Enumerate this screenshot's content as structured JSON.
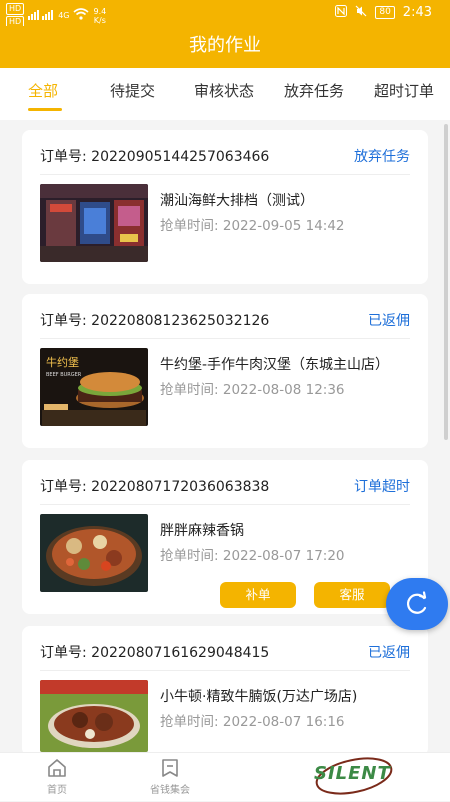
{
  "status_bar": {
    "net1": "HD",
    "net2": "HD",
    "signal_label": "4G",
    "speed_value": "9.4",
    "speed_unit": "K/s",
    "battery": "80",
    "time": "2:43"
  },
  "header": {
    "title": "我的作业"
  },
  "tabs": [
    {
      "label": "全部",
      "active": true
    },
    {
      "label": "待提交",
      "active": false
    },
    {
      "label": "审核状态",
      "active": false
    },
    {
      "label": "放弃任务",
      "active": false
    },
    {
      "label": "超时订单",
      "active": false
    }
  ],
  "orders": [
    {
      "order_label": "订单号:",
      "order_no": "20220905144257063466",
      "status": "放弃任务",
      "shop": "潮汕海鲜大排档（测试）",
      "time_label": "抢单时间:",
      "time": "2022-09-05 14:42",
      "image": "restaurant-storefront"
    },
    {
      "order_label": "订单号:",
      "order_no": "20220808123625032126",
      "status": "已返佣",
      "shop": "牛约堡-手作牛肉汉堡（东城主山店）",
      "time_label": "抢单时间:",
      "time": "2022-08-08 12:36",
      "image": "burger-ad",
      "image_caption": "牛约堡",
      "image_sub": "BEEF BURGER"
    },
    {
      "order_label": "订单号:",
      "order_no": "20220807172036063838",
      "status": "订单超时",
      "shop": "胖胖麻辣香锅",
      "time_label": "抢单时间:",
      "time": "2022-08-07 17:20",
      "image": "spicy-pot-dish",
      "buttons": [
        "补单",
        "客服"
      ]
    },
    {
      "order_label": "订单号:",
      "order_no": "20220807161629048415",
      "status": "已返佣",
      "shop": "小牛顿·精致牛腩饭(万达广场店)",
      "time_label": "抢单时间:",
      "time": "2022-08-07 16:16",
      "image": "beef-rice-dish"
    }
  ],
  "bottom_nav": [
    {
      "label": "首页",
      "icon": "home-icon"
    },
    {
      "label": "省钱集会",
      "icon": "coupon-icon"
    }
  ],
  "watermark": {
    "text": "SILENT"
  },
  "fab": {
    "icon": "refresh-icon"
  },
  "colors": {
    "brand": "#f4b400",
    "link": "#1e6fd9",
    "fab": "#2f7bf0"
  }
}
